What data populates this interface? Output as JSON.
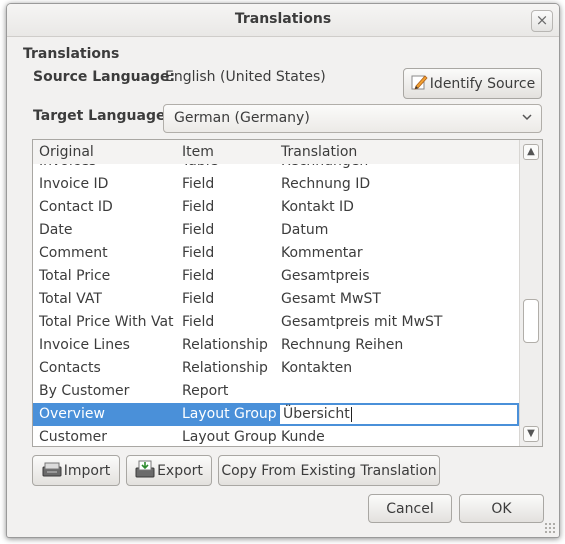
{
  "window": {
    "title": "Translations",
    "close_glyph": "×"
  },
  "section_title": "Translations",
  "source": {
    "label": "Source Language:",
    "value": "English (United States)"
  },
  "identify_button": {
    "icon": "pencil-note-icon",
    "label": "Identify Source"
  },
  "target": {
    "label": "Target Language:",
    "value": "German (Germany)"
  },
  "table": {
    "columns": [
      "Original",
      "Item",
      "Translation"
    ],
    "rows": [
      [
        "Invoices",
        "Table",
        "Rechnungen"
      ],
      [
        "Invoice ID",
        "Field",
        "Rechnung ID"
      ],
      [
        "Contact ID",
        "Field",
        "Kontakt ID"
      ],
      [
        "Date",
        "Field",
        "Datum"
      ],
      [
        "Comment",
        "Field",
        "Kommentar"
      ],
      [
        "Total Price",
        "Field",
        "Gesamtpreis"
      ],
      [
        "Total VAT",
        "Field",
        "Gesamt MwST"
      ],
      [
        "Total Price With Vat",
        "Field",
        "Gesamtpreis mit MwST"
      ],
      [
        "Invoice Lines",
        "Relationship",
        "Rechnung Reihen"
      ],
      [
        "Contacts",
        "Relationship",
        "Kontakten"
      ],
      [
        "By Customer",
        "Report",
        ""
      ],
      [
        "Overview",
        "Layout Group",
        "Übersicht"
      ],
      [
        "Customer",
        "Layout Group",
        "Kunde"
      ]
    ],
    "selected_index": 11
  },
  "buttons": {
    "import": "Import",
    "export": "Export",
    "copy_from": "Copy From Existing Translation",
    "cancel": "Cancel",
    "ok": "OK"
  },
  "colors": {
    "selection": "#4a90d9",
    "window_bg": "#f2f1f0"
  }
}
